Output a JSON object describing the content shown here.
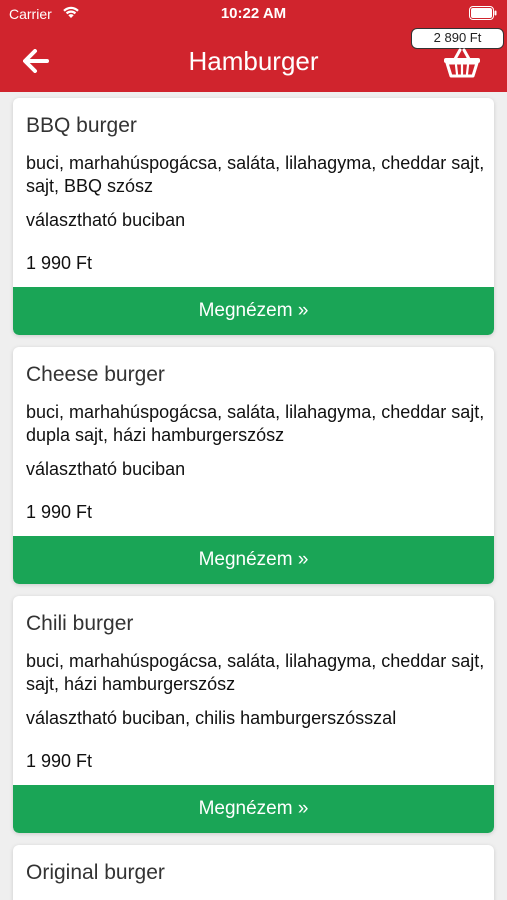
{
  "status_bar": {
    "carrier": "Carrier",
    "time": "10:22 AM"
  },
  "header": {
    "title": "Hamburger",
    "cart_total": "2 890 Ft"
  },
  "products": [
    {
      "name": "BBQ burger",
      "description": "buci, marhahúspogácsa, saláta, lilahagyma, cheddar sajt, sajt, BBQ szósz",
      "note": "választható buciban",
      "price": "1 990 Ft",
      "button": "Megnézem »"
    },
    {
      "name": "Cheese burger",
      "description": "buci, marhahúspogácsa, saláta, lilahagyma, cheddar sajt, dupla sajt, házi hamburgerszósz",
      "note": "választható buciban",
      "price": "1 990 Ft",
      "button": "Megnézem »"
    },
    {
      "name": "Chili burger",
      "description": "buci, marhahúspogácsa, saláta, lilahagyma, cheddar sajt, sajt, házi hamburgerszósz",
      "note": "választható buciban, chilis hamburgerszósszal",
      "price": "1 990 Ft",
      "button": "Megnézem »"
    },
    {
      "name": "Original burger"
    }
  ],
  "colors": {
    "header": "#d0242d",
    "button": "#1aa556",
    "background": "#efefef"
  }
}
